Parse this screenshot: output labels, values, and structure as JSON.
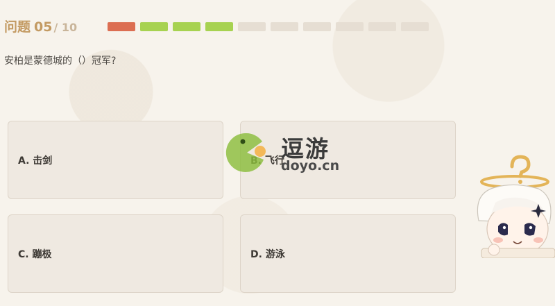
{
  "header": {
    "label": "问题",
    "current": "05",
    "total": "/ 10"
  },
  "progress": {
    "segments": [
      "wrong",
      "correct",
      "correct",
      "correct",
      "empty",
      "empty",
      "empty",
      "empty",
      "empty",
      "empty"
    ],
    "colors": {
      "wrong": "#dc6e52",
      "correct": "#a7d251",
      "empty": "#e6ded3"
    }
  },
  "question": {
    "text": "安柏是蒙德城的（）冠军?"
  },
  "options": [
    {
      "text": "A. 击剑"
    },
    {
      "text": "B. 飞行"
    },
    {
      "text": "C. 蹦极"
    },
    {
      "text": "D. 游泳"
    }
  ],
  "watermark": {
    "cn": "逗游",
    "en": "doyo.cn"
  },
  "mascot": {
    "icon": "paimon-mascot-icon"
  }
}
